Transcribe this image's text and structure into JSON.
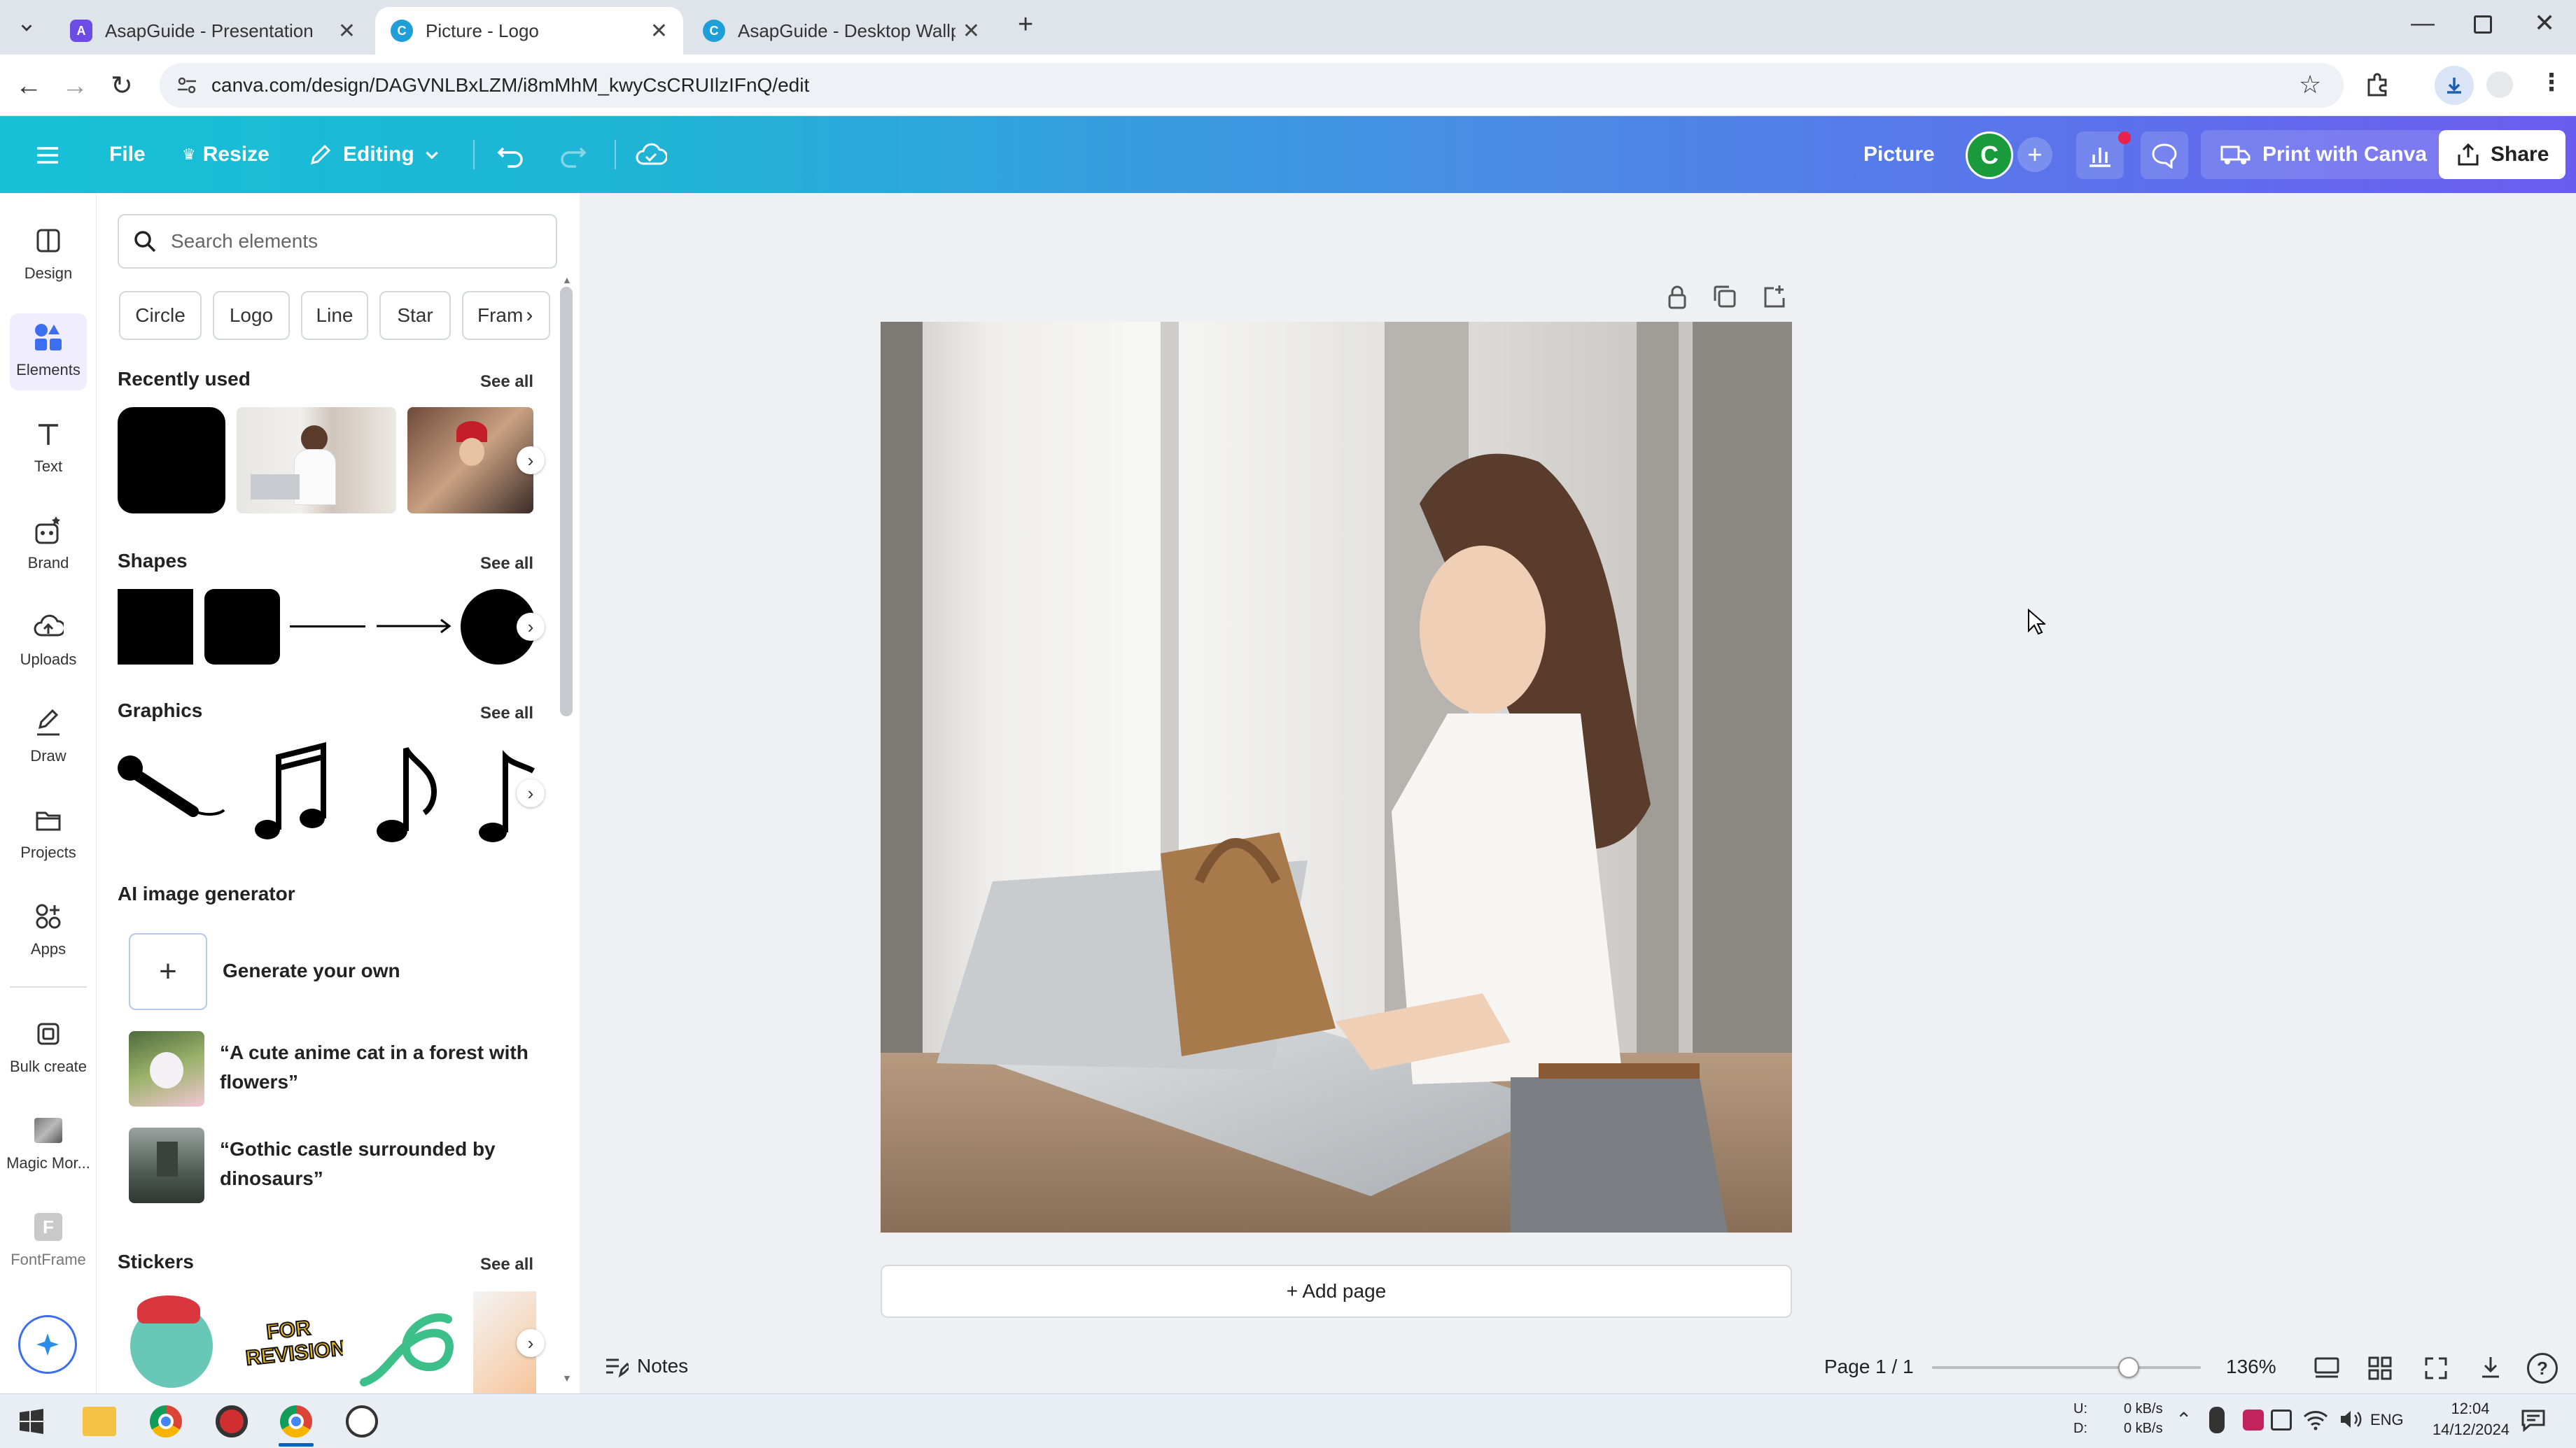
{
  "browser": {
    "tabs": [
      {
        "title": "AsapGuide - Presentation",
        "icon": "asapguide-icon",
        "color": "#6b4de6"
      },
      {
        "title": "Picture - Logo",
        "icon": "canva-icon",
        "color": "#1f9ed8"
      },
      {
        "title": "AsapGuide - Desktop Wallpape",
        "icon": "canva-icon",
        "color": "#1f9ed8"
      }
    ],
    "url": "canva.com/design/DAGVNLBxLZM/i8mMhM_kwyCsCRUIlzIFnQ/edit"
  },
  "header": {
    "file": "File",
    "resize": "Resize",
    "editing": "Editing",
    "title": "Picture",
    "avatar_letter": "C",
    "print": "Print with Canva",
    "share": "Share",
    "accent": "#6b5cf0"
  },
  "rail": [
    {
      "label": "Design",
      "icon": "design-icon"
    },
    {
      "label": "Elements",
      "icon": "elements-icon"
    },
    {
      "label": "Text",
      "icon": "text-icon"
    },
    {
      "label": "Brand",
      "icon": "brand-icon"
    },
    {
      "label": "Uploads",
      "icon": "uploads-icon"
    },
    {
      "label": "Draw",
      "icon": "draw-icon"
    },
    {
      "label": "Projects",
      "icon": "projects-icon"
    },
    {
      "label": "Apps",
      "icon": "apps-icon"
    },
    {
      "label": "Bulk create",
      "icon": "bulk-create-icon"
    },
    {
      "label": "Magic Mor...",
      "icon": "magic-morph-icon"
    },
    {
      "label": "FontFrame",
      "icon": "fontframe-icon"
    }
  ],
  "panel": {
    "search_placeholder": "Search elements",
    "chips": [
      "Circle",
      "Logo",
      "Line",
      "Star",
      "Fram"
    ],
    "recently_used": "Recently used",
    "shapes": "Shapes",
    "graphics": "Graphics",
    "ai_generator": "AI image generator",
    "generate_own": "Generate your own",
    "prompt1": "“A cute anime cat in a forest with flowers”",
    "prompt2": "“Gothic castle surrounded by dinosaurs”",
    "stickers": "Stickers",
    "see_all": "See all",
    "sticker_text": "FOR REVISION"
  },
  "canvas": {
    "add_page": "+ Add page"
  },
  "footer": {
    "notes": "Notes",
    "page": "Page 1 / 1",
    "zoom": "136%",
    "zoom_level": 0.75
  },
  "taskbar": {
    "net_up_label": "U:",
    "net_down_label": "D:",
    "net_up": "0 kB/s",
    "net_down": "0 kB/s",
    "lang": "ENG",
    "time": "12:04",
    "date": "14/12/2024"
  }
}
